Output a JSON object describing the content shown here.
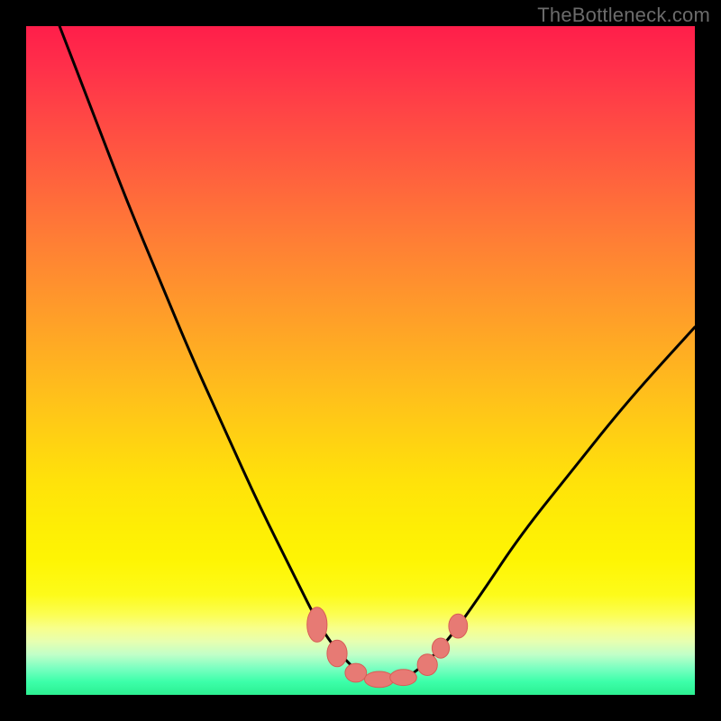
{
  "attribution": "TheBottleneck.com",
  "colors": {
    "curve": "#000000",
    "dot_fill": "#e77a74",
    "dot_stroke": "#d85d56",
    "background_black": "#000000"
  },
  "chart_data": {
    "type": "line",
    "title": "",
    "xlabel": "",
    "ylabel": "",
    "xlim": [
      0,
      100
    ],
    "ylim": [
      0,
      100
    ],
    "series": [
      {
        "name": "bottleneck-curve",
        "x": [
          5,
          10,
          15,
          20,
          25,
          30,
          35,
          40,
          44,
          47,
          50,
          53,
          56,
          59,
          63,
          68,
          74,
          82,
          90,
          100
        ],
        "y": [
          100,
          87,
          74,
          62,
          50,
          39,
          28,
          18,
          10,
          6,
          3,
          2,
          2,
          4,
          8,
          15,
          24,
          34,
          44,
          55
        ]
      }
    ],
    "markers": [
      {
        "x": 43.5,
        "y": 10.5,
        "rx": 1.5,
        "ry": 2.6
      },
      {
        "x": 46.5,
        "y": 6.2,
        "rx": 1.5,
        "ry": 2.0
      },
      {
        "x": 49.3,
        "y": 3.3,
        "rx": 1.6,
        "ry": 1.4
      },
      {
        "x": 52.8,
        "y": 2.3,
        "rx": 2.2,
        "ry": 1.2
      },
      {
        "x": 56.4,
        "y": 2.6,
        "rx": 2.0,
        "ry": 1.2
      },
      {
        "x": 60.0,
        "y": 4.5,
        "rx": 1.5,
        "ry": 1.6
      },
      {
        "x": 62.0,
        "y": 7.0,
        "rx": 1.3,
        "ry": 1.5
      },
      {
        "x": 64.6,
        "y": 10.3,
        "rx": 1.4,
        "ry": 1.8
      }
    ],
    "gradient_stops": [
      {
        "pos": 0,
        "color": "#ff1e4a"
      },
      {
        "pos": 25,
        "color": "#ff7e35"
      },
      {
        "pos": 50,
        "color": "#ffc21a"
      },
      {
        "pos": 75,
        "color": "#feee05"
      },
      {
        "pos": 90,
        "color": "#f8ff8b"
      },
      {
        "pos": 100,
        "color": "#2cf091"
      }
    ]
  }
}
